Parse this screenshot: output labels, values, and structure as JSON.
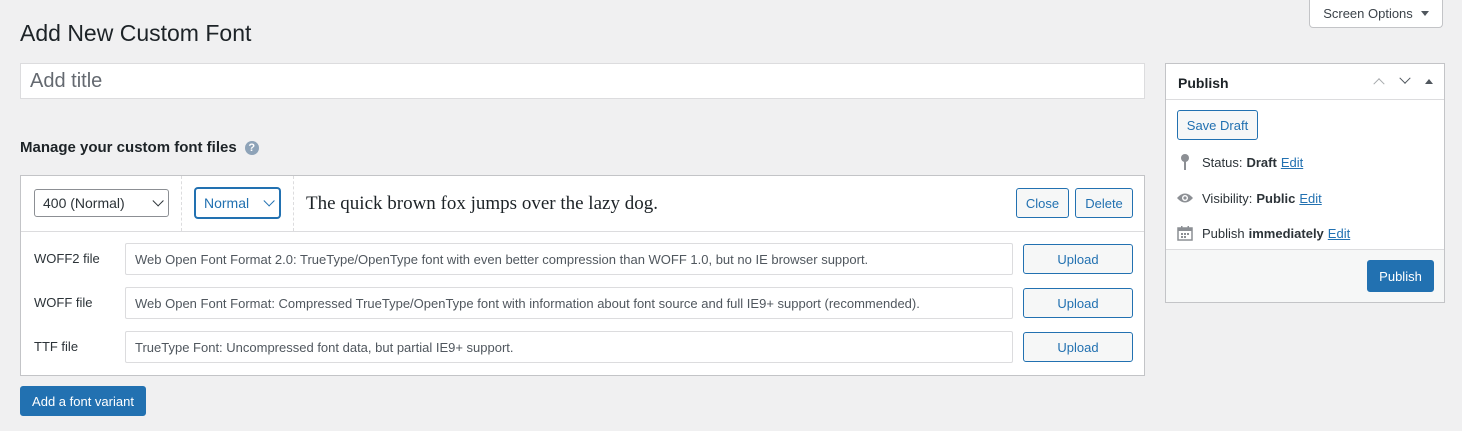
{
  "screen_options": {
    "label": "Screen Options"
  },
  "page": {
    "title": "Add New Custom Font"
  },
  "title_field": {
    "placeholder": "Add title",
    "value": ""
  },
  "font_files": {
    "heading": "Manage your custom font files",
    "help_icon": "?",
    "variant": {
      "weight_selected": "400 (Normal)",
      "style_selected": "Normal",
      "preview_text": "The quick brown fox jumps over the lazy dog.",
      "close_label": "Close",
      "delete_label": "Delete",
      "files": [
        {
          "label": "WOFF2 file",
          "placeholder": "Web Open Font Format 2.0: TrueType/OpenType font with even better compression than WOFF 1.0, but no IE browser support.",
          "upload_label": "Upload"
        },
        {
          "label": "WOFF file",
          "placeholder": "Web Open Font Format: Compressed TrueType/OpenType font with information about font source and full IE9+ support (recommended).",
          "upload_label": "Upload"
        },
        {
          "label": "TTF file",
          "placeholder": "TrueType Font: Uncompressed font data, but partial IE9+ support.",
          "upload_label": "Upload"
        }
      ]
    },
    "add_variant_label": "Add a font variant"
  },
  "publish": {
    "title": "Publish",
    "save_draft_label": "Save Draft",
    "status_label": "Status:",
    "status_value": "Draft",
    "visibility_label": "Visibility:",
    "visibility_value": "Public",
    "schedule_label": "Publish",
    "schedule_value": "immediately",
    "edit_label": "Edit",
    "publish_button_label": "Publish",
    "icons": [
      "pin-icon",
      "eye-icon",
      "calendar-icon"
    ]
  },
  "colors": {
    "accent": "#2271b1",
    "background": "#f0f0f1",
    "border": "#c3c4c7"
  }
}
